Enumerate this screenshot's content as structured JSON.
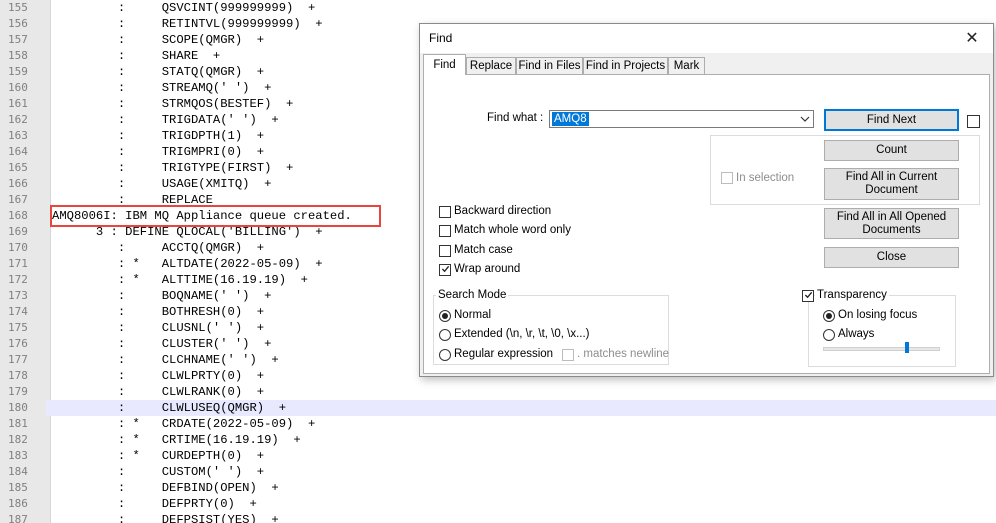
{
  "editor": {
    "highlight_color": "#e8453c",
    "lines": [
      {
        "num": "155",
        "text": "         :     QSVCINT(999999999)  +"
      },
      {
        "num": "156",
        "text": "         :     RETINTVL(999999999)  +"
      },
      {
        "num": "157",
        "text": "         :     SCOPE(QMGR)  +"
      },
      {
        "num": "158",
        "text": "         :     SHARE  +"
      },
      {
        "num": "159",
        "text": "         :     STATQ(QMGR)  +"
      },
      {
        "num": "160",
        "text": "         :     STREAMQ(' ')  +"
      },
      {
        "num": "161",
        "text": "         :     STRMQOS(BESTEF)  +"
      },
      {
        "num": "162",
        "text": "         :     TRIGDATA(' ')  +"
      },
      {
        "num": "163",
        "text": "         :     TRIGDPTH(1)  +"
      },
      {
        "num": "164",
        "text": "         :     TRIGMPRI(0)  +"
      },
      {
        "num": "165",
        "text": "         :     TRIGTYPE(FIRST)  +"
      },
      {
        "num": "166",
        "text": "         :     USAGE(XMITQ)  +"
      },
      {
        "num": "167",
        "text": "         :     REPLACE"
      },
      {
        "num": "168",
        "text": "AMQ8006I: IBM MQ Appliance queue created."
      },
      {
        "num": "169",
        "text": "      3 : DEFINE QLOCAL('BILLING')  +"
      },
      {
        "num": "170",
        "text": "         :     ACCTQ(QMGR)  +"
      },
      {
        "num": "171",
        "text": "         : *   ALTDATE(2022-05-09)  +"
      },
      {
        "num": "172",
        "text": "         : *   ALTTIME(16.19.19)  +"
      },
      {
        "num": "173",
        "text": "         :     BOQNAME(' ')  +"
      },
      {
        "num": "174",
        "text": "         :     BOTHRESH(0)  +"
      },
      {
        "num": "175",
        "text": "         :     CLUSNL(' ')  +"
      },
      {
        "num": "176",
        "text": "         :     CLUSTER(' ')  +"
      },
      {
        "num": "177",
        "text": "         :     CLCHNAME(' ')  +"
      },
      {
        "num": "178",
        "text": "         :     CLWLPRTY(0)  +"
      },
      {
        "num": "179",
        "text": "         :     CLWLRANK(0)  +"
      },
      {
        "num": "180",
        "text": "         :     CLWLUSEQ(QMGR)  +"
      },
      {
        "num": "181",
        "text": "         : *   CRDATE(2022-05-09)  +"
      },
      {
        "num": "182",
        "text": "         : *   CRTIME(16.19.19)  +"
      },
      {
        "num": "183",
        "text": "         : *   CURDEPTH(0)  +"
      },
      {
        "num": "184",
        "text": "         :     CUSTOM(' ')  +"
      },
      {
        "num": "185",
        "text": "         :     DEFBIND(OPEN)  +"
      },
      {
        "num": "186",
        "text": "         :     DEFPRTY(0)  +"
      },
      {
        "num": "187",
        "text": "         :     DEFPSIST(YES)  +"
      }
    ]
  },
  "dialog": {
    "title": "Find",
    "close_glyph": "✕",
    "tabs": [
      "Find",
      "Replace",
      "Find in Files",
      "Find in Projects",
      "Mark"
    ],
    "find_what_label": "Find what :",
    "find_what_value": "AMQ8",
    "buttons": {
      "find_next": "Find Next",
      "count": "Count",
      "find_all_current": "Find All in Current Document",
      "find_all_opened": "Find All in All Opened Documents",
      "close": "Close"
    },
    "in_selection": "In selection",
    "options": {
      "backward": "Backward direction",
      "whole_word": "Match whole word only",
      "match_case": "Match case",
      "wrap": "Wrap around"
    },
    "search_mode": {
      "title": "Search Mode",
      "normal": "Normal",
      "extended": "Extended (\\n, \\r, \\t, \\0, \\x...)",
      "regex": "Regular expression",
      "matches_newline": ". matches newline"
    },
    "transparency": {
      "title": "Transparency",
      "on_losing_focus": "On losing focus",
      "always": "Always",
      "level": 0.72
    },
    "accent_color": "#0078d7"
  }
}
